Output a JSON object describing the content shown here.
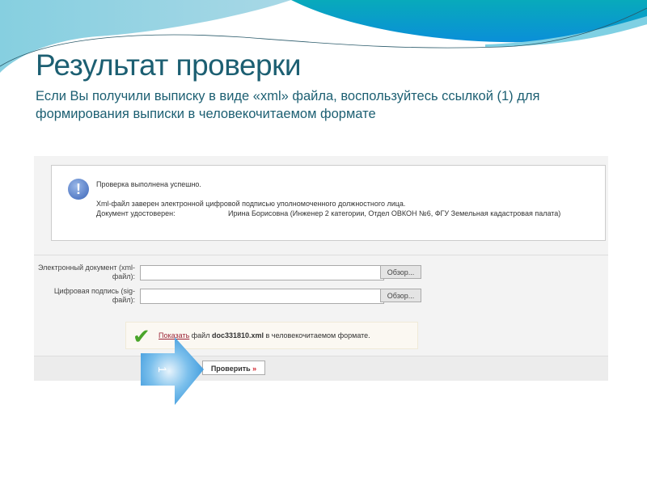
{
  "slide": {
    "title": "Результат проверки",
    "subtitle": "Если Вы получили выписку в виде «xml» файла, воспользуйтесь ссылкой (1) для формирования выписки в человекочитаемом формате"
  },
  "message": {
    "icon": "exclamation-icon",
    "status": "Проверка выполнена успешно.",
    "line1": "Xml-файл заверен электронной цифровой подписью уполномоченного должностного лица.",
    "certified_label": "Документ удостоверен:",
    "certified_value": "Ирина Борисовна (Инженер 2 категории, Отдел ОВКОН №6, ФГУ Земельная кадастровая палата)"
  },
  "form": {
    "doc_label": "Электронный документ (xml-файл):",
    "sig_label": "Цифровая подпись (sig-файл):",
    "doc_value": "",
    "sig_value": "",
    "browse_label": "Обзор..."
  },
  "result": {
    "link": "Показать",
    "text_before": " файл ",
    "filename": "doc331810.xml",
    "text_after": " в человекочитаемом формате."
  },
  "check_button": {
    "label": "Проверить",
    "suffix": " »"
  },
  "callout": {
    "number": "1",
    "color": "#4aa3e0"
  },
  "colors": {
    "title": "#1c5f72",
    "accent": "#0aa0c8"
  }
}
